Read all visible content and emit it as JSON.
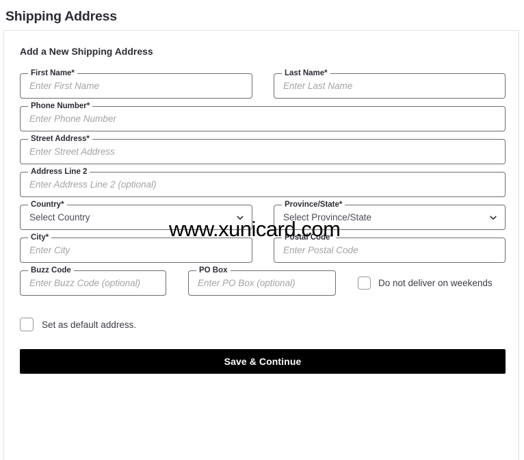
{
  "page": {
    "title": "Shipping Address"
  },
  "card": {
    "title": "Add a New Shipping Address"
  },
  "watermark": {
    "text": "www.xunicard.com"
  },
  "form": {
    "fields": [
      {
        "name": "first-name",
        "label": "First Name*",
        "placeholder": "Enter First Name",
        "value": ""
      },
      {
        "name": "last-name",
        "label": "Last Name*",
        "placeholder": "Enter Last Name",
        "value": ""
      },
      {
        "name": "phone-number",
        "label": "Phone Number*",
        "placeholder": "Enter Phone Number",
        "value": ""
      },
      {
        "name": "street-address",
        "label": "Street Address*",
        "placeholder": "Enter Street Address",
        "value": ""
      },
      {
        "name": "address-line-2",
        "label": "Address Line 2",
        "placeholder": "Enter Address Line 2 (optional)",
        "value": ""
      },
      {
        "name": "country",
        "label": "Country*",
        "selected": "Select Country",
        "options": [
          "Select Country"
        ]
      },
      {
        "name": "province-state",
        "label": "Province/State*",
        "selected": "Select Province/State",
        "options": [
          "Select Province/State"
        ]
      },
      {
        "name": "city",
        "label": "City*",
        "placeholder": "Enter City",
        "value": ""
      },
      {
        "name": "postal-code",
        "label": "Postal Code*",
        "placeholder": "Enter Postal Code",
        "value": ""
      },
      {
        "name": "buzz-code",
        "label": "Buzz Code",
        "placeholder": "Enter Buzz Code (optional)",
        "value": ""
      },
      {
        "name": "po-box",
        "label": "PO Box",
        "placeholder": "Enter PO Box (optional)",
        "value": ""
      }
    ],
    "checkboxes": [
      {
        "name": "no-weekend-delivery",
        "label": "Do not deliver on weekends",
        "checked": false
      },
      {
        "name": "set-default-address",
        "label": "Set as default address.",
        "checked": false
      }
    ],
    "submit_label": "Save & Continue"
  },
  "colors": {
    "field_border": "#6d6d6d",
    "card_border": "#e2e2e2",
    "text": "#2b2b35",
    "placeholder": "#a3a3a3",
    "button_bg": "#000000",
    "button_text": "#ffffff"
  }
}
